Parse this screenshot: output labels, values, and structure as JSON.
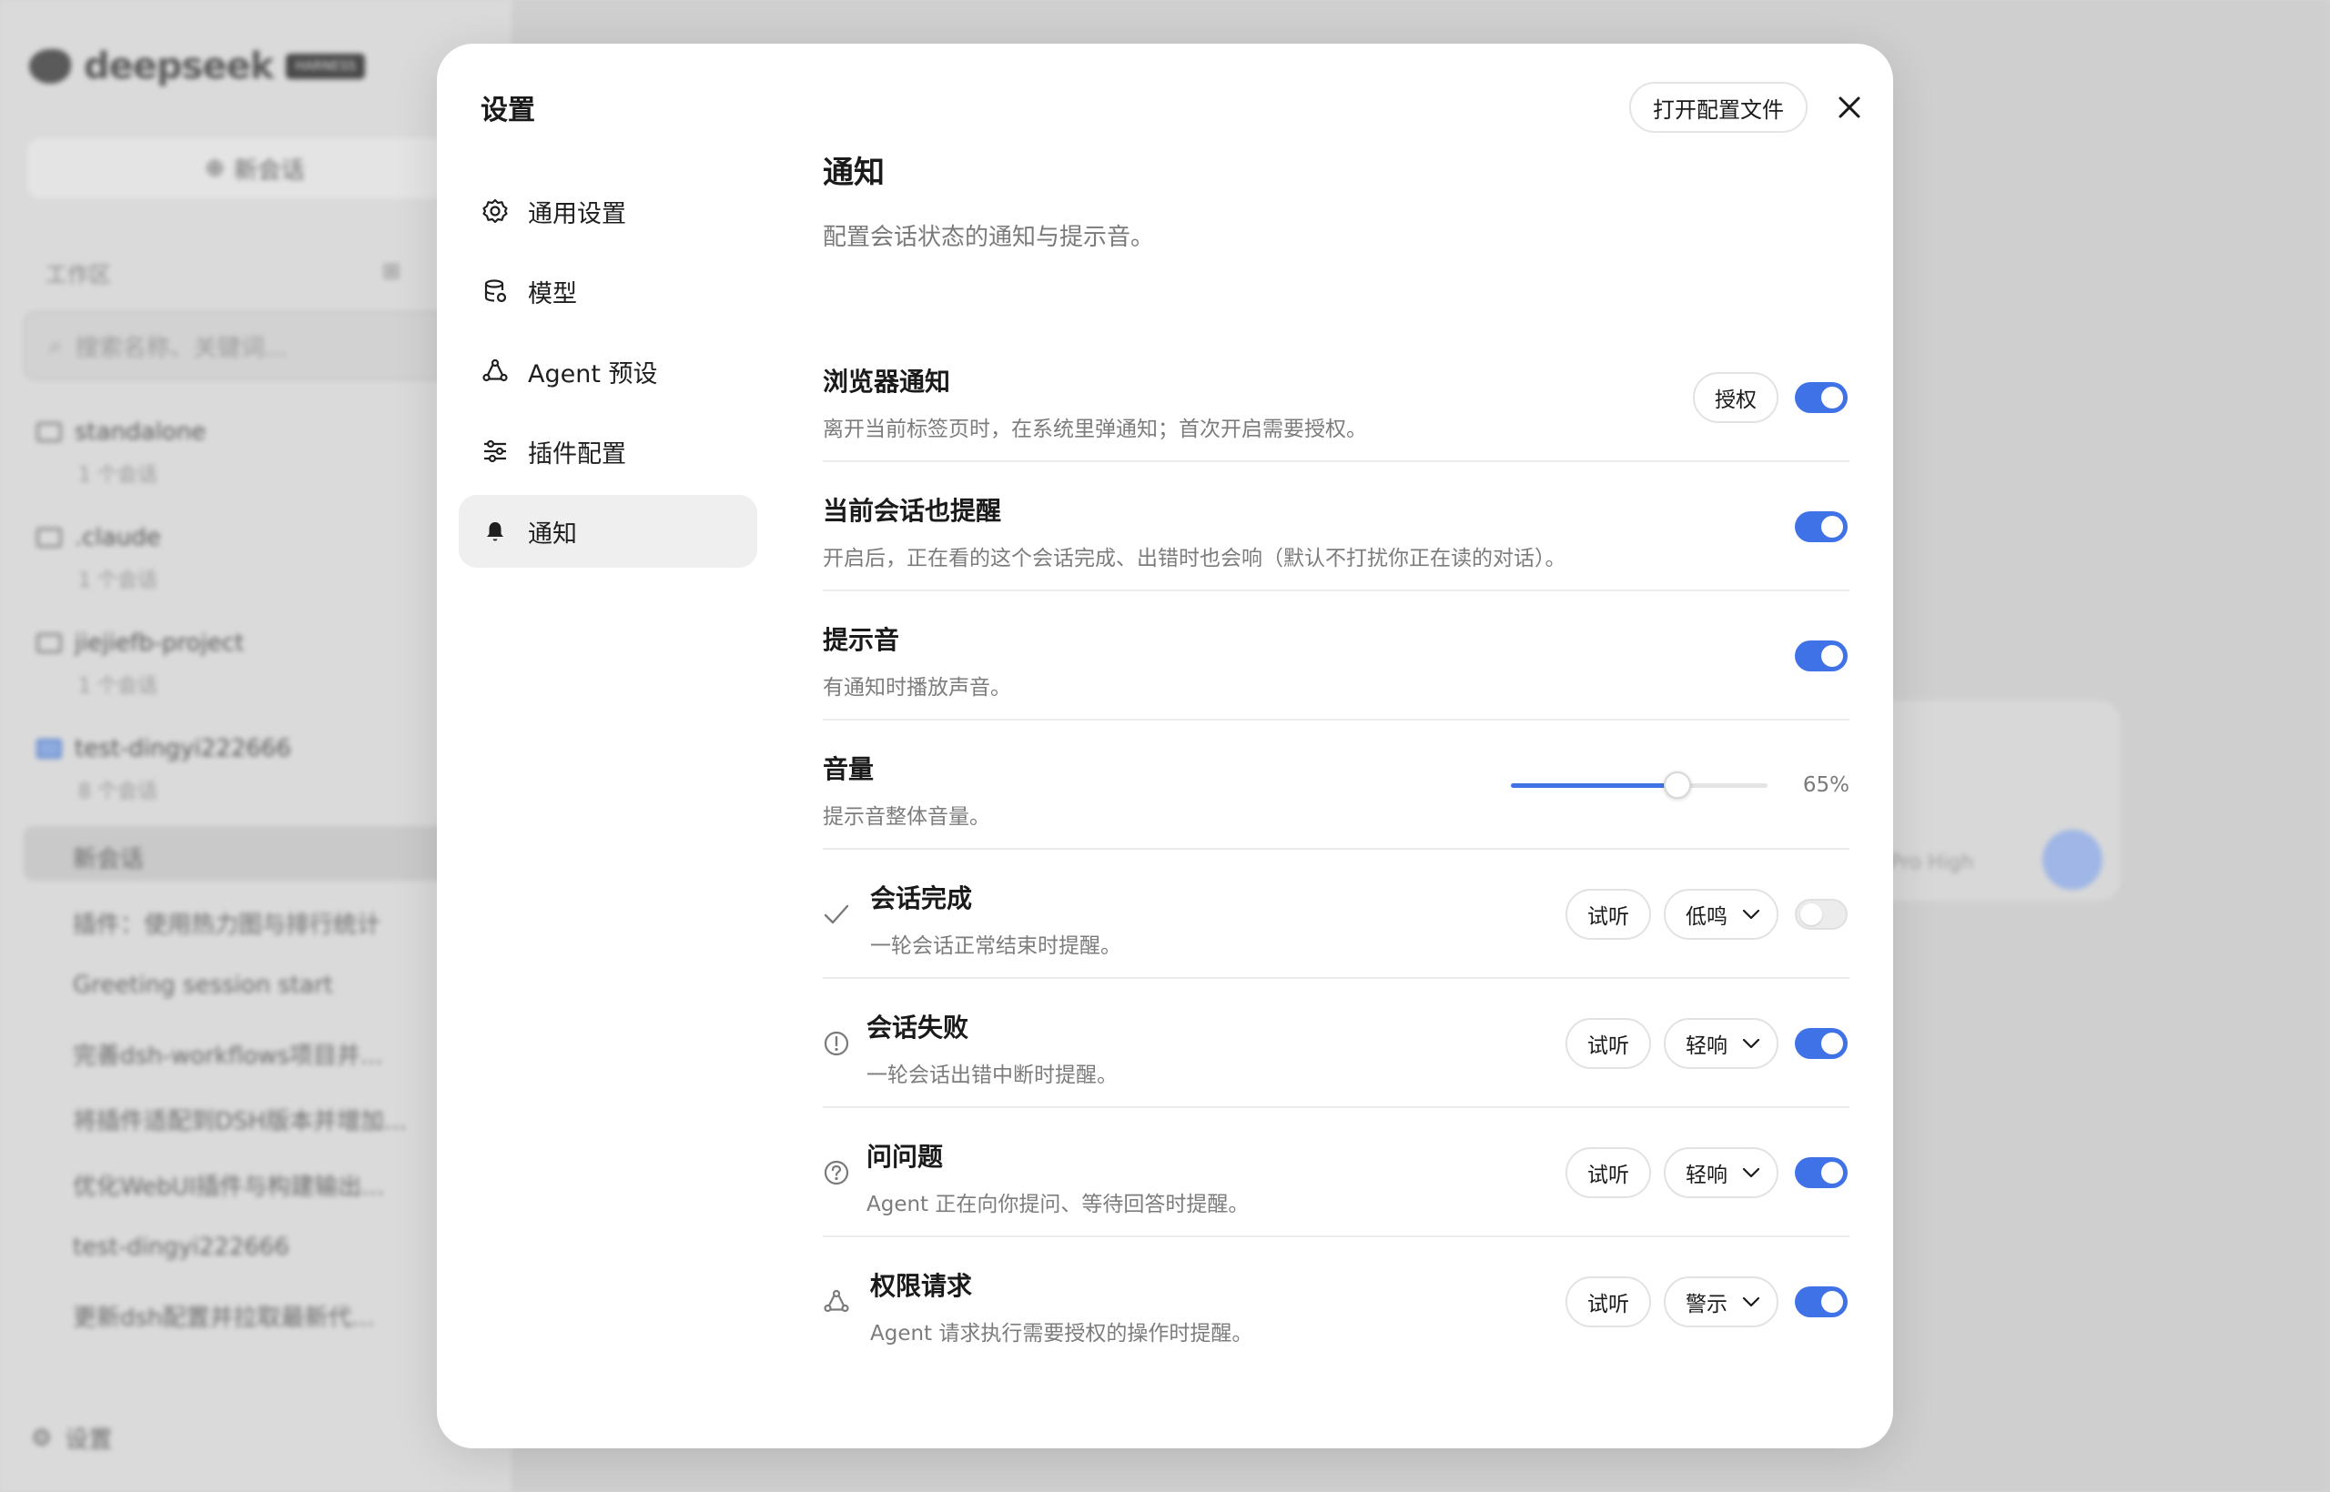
{
  "background": {
    "logo_text": "deepseek",
    "logo_badge": "HARNESS",
    "new_chat": "新会话",
    "workspace_label": "工作区",
    "search_placeholder": "搜索名称、关键词...",
    "projects": [
      {
        "name": "standalone",
        "count": "1 个会话"
      },
      {
        "name": ".claude",
        "count": "1 个会话"
      },
      {
        "name": "jiejiefb-project",
        "count": "1 个会话"
      },
      {
        "name": "test-dingyi222666",
        "count": "8 个会话"
      }
    ],
    "sessions": [
      "新会话",
      "插件：使用热力图与排行统计",
      "Greeting session start",
      "完善dsh-workflows项目并...",
      "将插件适配到DSH版本并增加...",
      "优化WebUI插件与构建输出...",
      "test-dingyi222666",
      "更新dsh配置并拉取最新代..."
    ],
    "settings_label": "设置",
    "model_text": "Pro High"
  },
  "modal": {
    "title": "设置",
    "open_config": "打开配置文件",
    "nav": [
      {
        "label": "通用设置",
        "icon": "gear-icon"
      },
      {
        "label": "模型",
        "icon": "database-icon"
      },
      {
        "label": "Agent 预设",
        "icon": "agent-icon"
      },
      {
        "label": "插件配置",
        "icon": "sliders-icon"
      },
      {
        "label": "通知",
        "icon": "bell-icon",
        "active": true
      }
    ],
    "section": {
      "title": "通知",
      "description": "配置会话状态的通知与提示音。"
    },
    "rows": {
      "browser": {
        "title": "浏览器通知",
        "desc": "离开当前标签页时，在系统里弹通知；首次开启需要授权。",
        "authorize": "授权",
        "enabled": true
      },
      "current": {
        "title": "当前会话也提醒",
        "desc": "开启后，正在看的这个会话完成、出错时也会响（默认不打扰你正在读的对话）。",
        "enabled": true
      },
      "sound": {
        "title": "提示音",
        "desc": "有通知时播放声音。",
        "enabled": true
      },
      "volume": {
        "title": "音量",
        "desc": "提示音整体音量。",
        "value": 65,
        "value_label": "65%"
      },
      "complete": {
        "title": "会话完成",
        "desc": "一轮会话正常结束时提醒。",
        "preview": "试听",
        "sound": "低鸣",
        "enabled": false,
        "icon": "check-icon"
      },
      "failed": {
        "title": "会话失败",
        "desc": "一轮会话出错中断时提醒。",
        "preview": "试听",
        "sound": "轻响",
        "enabled": true,
        "icon": "alert-circle-icon"
      },
      "question": {
        "title": "问问题",
        "desc": "Agent 正在向你提问、等待回答时提醒。",
        "preview": "试听",
        "sound": "轻响",
        "enabled": true,
        "icon": "question-circle-icon"
      },
      "permission": {
        "title": "权限请求",
        "desc": "Agent 请求执行需要授权的操作时提醒。",
        "preview": "试听",
        "sound": "警示",
        "enabled": true,
        "icon": "agent-icon"
      }
    },
    "colors": {
      "accent": "#3f72e6",
      "toggle_off": "#ececec"
    }
  }
}
